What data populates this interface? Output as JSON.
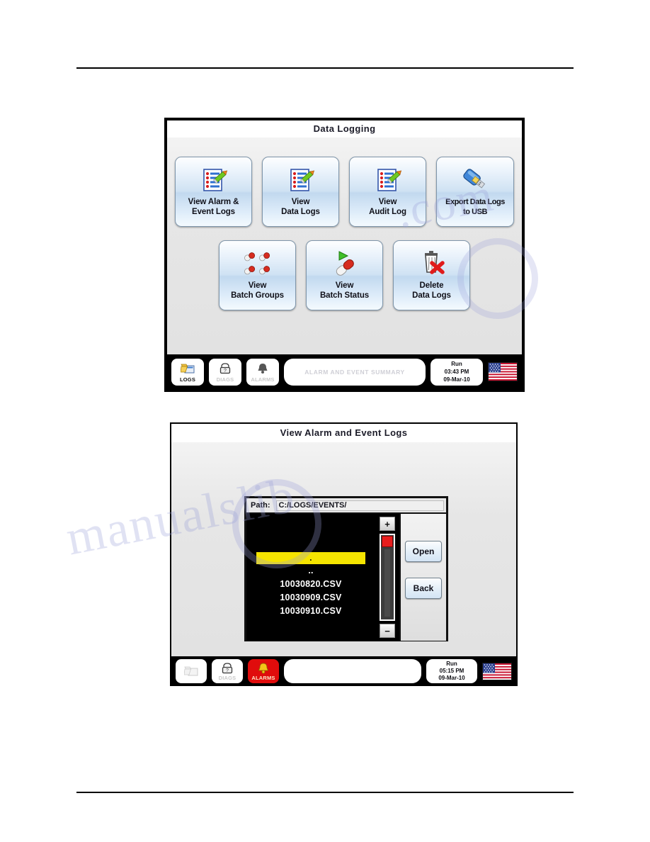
{
  "panel1": {
    "title": "Data Logging",
    "buttons_row1": [
      {
        "label": "View Alarm &\nEvent Logs",
        "icon": "checklist-pencil-icon"
      },
      {
        "label": "View\nData Logs",
        "icon": "checklist-pencil-icon"
      },
      {
        "label": "View\nAudit Log",
        "icon": "checklist-pencil-icon"
      },
      {
        "label": "Export Data Logs\nto USB",
        "icon": "usb-drive-icon"
      }
    ],
    "buttons_row2": [
      {
        "label": "View\nBatch Groups",
        "icon": "capsule-group-icon"
      },
      {
        "label": "View\nBatch Status",
        "icon": "capsule-play-icon"
      },
      {
        "label": "Delete\nData Logs",
        "icon": "trash-delete-icon"
      }
    ],
    "taskbar": {
      "logs_label": "LOGS",
      "diags_label": "DIAGS",
      "alarms_label": "ALARMS",
      "summary_text": "ALARM AND EVENT SUMMARY",
      "status_mode": "Run",
      "status_time": "03:43 PM",
      "status_date": "09-Mar-10",
      "flag": "us-flag-icon"
    }
  },
  "panel2": {
    "title": "View Alarm and Event Logs",
    "path_label": "Path:",
    "path_value": "C:/LOGS/EVENTS/",
    "files": [
      {
        "name": ".",
        "selected": true
      },
      {
        "name": "..",
        "selected": false
      },
      {
        "name": "10030820.CSV",
        "selected": false
      },
      {
        "name": "10030909.CSV",
        "selected": false
      },
      {
        "name": "10030910.CSV",
        "selected": false
      }
    ],
    "scroll": {
      "up_label": "+",
      "down_label": "−"
    },
    "side_buttons": [
      {
        "label": "Open"
      },
      {
        "label": "Back"
      }
    ],
    "taskbar": {
      "logs_label": "",
      "diags_label": "DIAGS",
      "alarms_label": "ALARMS",
      "summary_text": "",
      "status_mode": "Run",
      "status_time": "05:15 PM",
      "status_date": "09-Mar-10",
      "flag": "us-flag-icon"
    }
  },
  "watermark": {
    "line_a": "manualslib",
    "line_b": ".com"
  },
  "colors": {
    "alarm_red": "#e00c0c",
    "selection_yellow": "#f5e400",
    "button_blue": "#cfe2f3",
    "panel_black": "#000000"
  }
}
